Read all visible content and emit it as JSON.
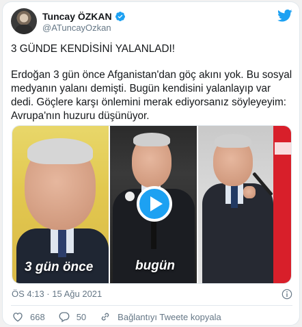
{
  "author": {
    "display_name": "Tuncay ÖZKAN",
    "handle": "@ATuncayOzkan",
    "verified": true,
    "avatar_icon": "user-avatar"
  },
  "brand": {
    "logo_icon": "twitter-bird-icon",
    "accent": "#1da1f2"
  },
  "tweet": {
    "headline": "3 GÜNDE KENDİSİNİ YALANLADI!",
    "body": "Erdoğan 3 gün önce Afganistan'dan göç akını yok. Bu sosyal medyanın yalanı demişti. Bugün kendisini yalanlayıp var dedi. Göçlere karşı önlemini merak ediyorsanız söyleyeyim: Avrupa'nın huzuru düşünüyor."
  },
  "media": {
    "caption_left": "3 gün önce",
    "caption_middle": "bugün",
    "play_icon": "play-icon"
  },
  "meta": {
    "timestamp": "ÖS 4:13 · 15 Ağu 2021",
    "info_icon": "info-icon"
  },
  "actions": {
    "likes_count": "668",
    "replies_count": "50",
    "copy_link_label": "Bağlantıyı Tweete kopyala"
  }
}
